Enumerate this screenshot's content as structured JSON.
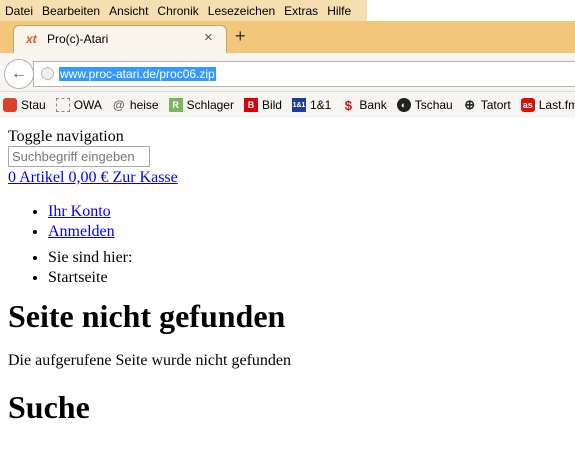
{
  "menu": [
    "Datei",
    "Bearbeiten",
    "Ansicht",
    "Chronik",
    "Lesezeichen",
    "Extras",
    "Hilfe"
  ],
  "tab": {
    "favicon": "xt",
    "title": "Pro(c)-Atari",
    "close": "×",
    "new_tab": "+"
  },
  "navbar": {
    "back": "←",
    "url": "www.proc-atari.de/proc06.zip"
  },
  "bookmarks": [
    {
      "icon": "stau-icon",
      "label": "Stau",
      "color": "#d9412b"
    },
    {
      "icon": "owa-icon",
      "label": "OWA",
      "color": "#ffffff"
    },
    {
      "icon": "heise-icon",
      "label": "heise",
      "color": "#ffffff"
    },
    {
      "icon": "schlager-icon",
      "label": "Schlager",
      "color": "#7bb661"
    },
    {
      "icon": "bild-icon",
      "label": "Bild",
      "color": "#d8000f"
    },
    {
      "icon": "1und1-icon",
      "label": "1&1",
      "color": "#1c3f94"
    },
    {
      "icon": "bank-icon",
      "label": "Bank",
      "color": "#e30613"
    },
    {
      "icon": "tschau-icon",
      "label": "Tschau",
      "color": "#222222"
    },
    {
      "icon": "tatort-icon",
      "label": "Tatort",
      "color": "#222222"
    },
    {
      "icon": "lastfm-icon",
      "label": "Last.fm",
      "color": "#d51007"
    }
  ],
  "page": {
    "toggle": "Toggle navigation",
    "search_placeholder": "Suchbegriff eingeben",
    "cart": "0 Artikel 0,00 € Zur Kasse",
    "account_links": [
      "Ihr Konto",
      "Anmelden"
    ],
    "breadcrumb": [
      "Sie sind hier:",
      "Startseite"
    ],
    "heading": "Seite nicht gefunden",
    "message": "Die aufgerufene Seite wurde nicht gefunden",
    "search_heading": "Suche"
  }
}
